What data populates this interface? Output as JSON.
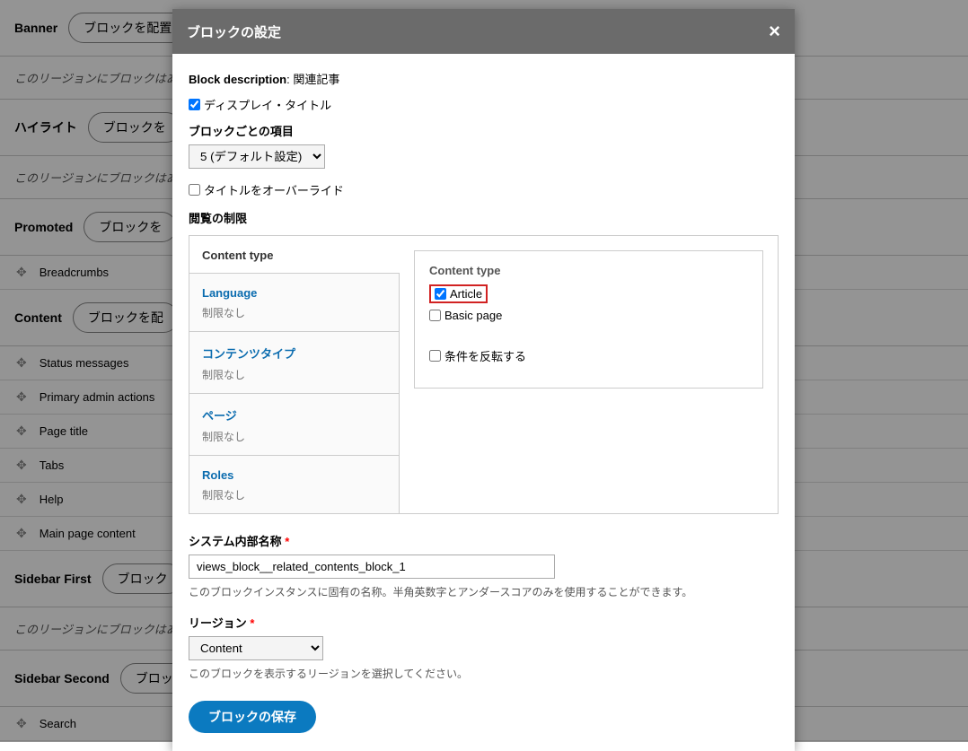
{
  "bg": {
    "rows": [
      {
        "type": "region",
        "label": "Banner",
        "btn": "ブロックを配置"
      },
      {
        "type": "msg",
        "text": "このリージョンにブロックはありません"
      },
      {
        "type": "region",
        "label": "ハイライト",
        "btn": "ブロックを"
      },
      {
        "type": "msg",
        "text": "このリージョンにブロックはありません"
      },
      {
        "type": "region",
        "label": "Promoted",
        "btn": "ブロックを"
      },
      {
        "type": "block",
        "text": "Breadcrumbs"
      },
      {
        "type": "region",
        "label": "Content",
        "btn": "ブロックを配"
      },
      {
        "type": "block",
        "text": "Status messages"
      },
      {
        "type": "block",
        "text": "Primary admin actions"
      },
      {
        "type": "block",
        "text": "Page title"
      },
      {
        "type": "block",
        "text": "Tabs"
      },
      {
        "type": "block",
        "text": "Help"
      },
      {
        "type": "block",
        "text": "Main page content"
      },
      {
        "type": "region",
        "label": "Sidebar First",
        "btn": "ブロック"
      },
      {
        "type": "msg",
        "text": "このリージョンにブロックはありません"
      },
      {
        "type": "region",
        "label": "Sidebar Second",
        "btn": "ブロッ"
      },
      {
        "type": "block",
        "text": "Search"
      }
    ]
  },
  "modal": {
    "title": "ブロックの設定",
    "block_desc_label": "Block description",
    "block_desc_value": "関連記事",
    "display_title": "ディスプレイ・タイトル",
    "items_per_block_label": "ブロックごとの項目",
    "items_per_block_value": "5 (デフォルト設定)",
    "override_title": "タイトルをオーバーライド",
    "visibility_label": "閲覧の制限",
    "vtabs": [
      {
        "title": "Content type",
        "sub": "",
        "active": true
      },
      {
        "title": "Language",
        "sub": "制限なし"
      },
      {
        "title": "コンテンツタイプ",
        "sub": "制限なし"
      },
      {
        "title": "ページ",
        "sub": "制限なし"
      },
      {
        "title": "Roles",
        "sub": "制限なし"
      }
    ],
    "inner_title": "Content type",
    "opt_article": "Article",
    "opt_basic": "Basic page",
    "negate": "条件を反転する",
    "machine_label": "システム内部名称",
    "machine_value": "views_block__related_contents_block_1",
    "machine_help": "このブロックインスタンスに固有の名称。半角英数字とアンダースコアのみを使用することができます。",
    "region_label": "リージョン",
    "region_value": "Content",
    "region_help": "このブロックを表示するリージョンを選択してください。",
    "save": "ブロックの保存"
  }
}
